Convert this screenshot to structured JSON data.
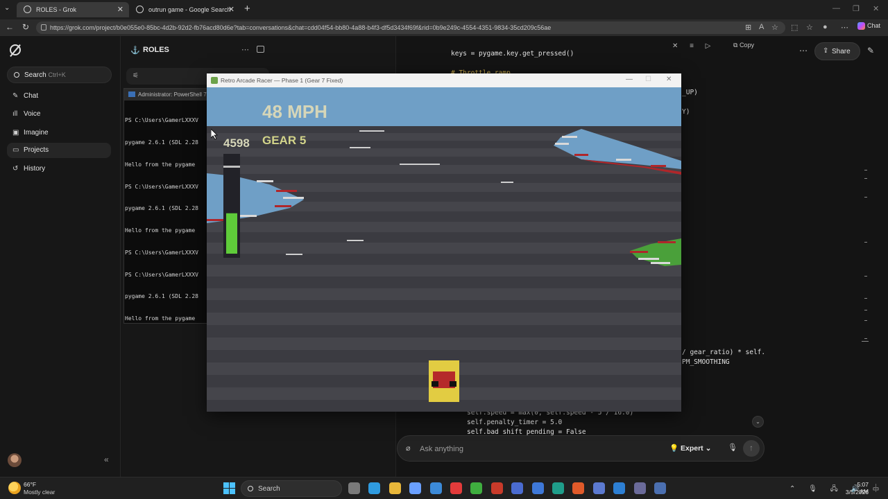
{
  "browser": {
    "tabs": [
      {
        "title": "ROLES - Grok",
        "active": true
      },
      {
        "title": "outrun game - Google Search",
        "active": false
      }
    ],
    "url": "https://grok.com/project/b0e055e0-85bc-4d2b-92d2-fb76acd80d6e?tab=conversations&chat=cdd04f54-bb80-4a88-b4f3-df5d3434f69f&rid=0b9e249c-4554-4351-9834-35cd209c56ae",
    "copilot_label": "Chat"
  },
  "grok_sidebar": {
    "search_label": "Search",
    "search_shortcut": "Ctrl+K",
    "items": [
      {
        "label": "Chat",
        "icon": "chat-bubble-icon",
        "active": false
      },
      {
        "label": "Voice",
        "icon": "waveform-icon",
        "active": false
      },
      {
        "label": "Imagine",
        "icon": "image-icon",
        "active": false
      },
      {
        "label": "Projects",
        "icon": "folder-icon",
        "active": true
      },
      {
        "label": "History",
        "icon": "history-icon",
        "active": false
      }
    ]
  },
  "project": {
    "title": "ROLES"
  },
  "powershell": {
    "title": "Administrator: PowerShell 7",
    "lines": [
      "PS C:\\Users\\GamerLXXXV",
      "pygame 2.6.1 (SDL 2.28",
      "Hello from the pygame",
      "PS C:\\Users\\GamerLXXXV",
      "pygame 2.6.1 (SDL 2.28",
      "Hello from the pygame",
      "PS C:\\Users\\GamerLXXXV",
      "PS C:\\Users\\GamerLXXXV",
      "pygame 2.6.1 (SDL 2.28",
      "Hello from the pygame"
    ]
  },
  "code": {
    "copy_label": "Copy",
    "line_top": "keys = pygame.key.get_pressed()",
    "line_comment": "# Throttle ramp",
    "frag_up": "_UP)",
    "frag_y": "Y)",
    "frag_gear": "/ gear_ratio) * self.",
    "frag_smooth": "PM_SMOOTHING",
    "line_speed": "self.speed = max(0, self.speed - 5 / 16.0)",
    "line_penalty": "self.penalty_timer = 5.0",
    "line_badshift": "self.bad_shift_pending = False"
  },
  "chat_input": {
    "placeholder": "Ask anything",
    "mode": "Expert"
  },
  "header_right": {
    "share_label": "Share"
  },
  "game": {
    "window_title": "Retro Arcade Racer — Phase 1 (Gear 7 Fixed)",
    "speed_text": "48 MPH",
    "rpm_text": "4598",
    "gear_text": "GEAR 5",
    "rpm_fill_fraction": 0.47,
    "colors": {
      "sky": "#6f9fc6",
      "road_dark": "#3b3b41",
      "road_light": "#45454b",
      "hud_text": "#d6d6b8",
      "gear_text": "#d2d48a",
      "rpm_bar": "#5fcc3a",
      "car_body": "#e2cc42",
      "car_top": "#b52a2a"
    }
  },
  "taskbar": {
    "weather_temp": "66°F",
    "weather_desc": "Mostly clear",
    "search_label": "Search",
    "time": "5:07 AM",
    "date": "3/5/2026",
    "apps": [
      "file-explorer-icon",
      "edge-icon",
      "folder-icon",
      "copilot-icon",
      "store-icon",
      "opera-icon",
      "xbox-icon",
      "game-icon",
      "terminal-icon",
      "mail-icon",
      "app-icon",
      "brave-icon",
      "powershell-icon",
      "vscode-icon",
      "snip-icon",
      "python-icon"
    ]
  }
}
